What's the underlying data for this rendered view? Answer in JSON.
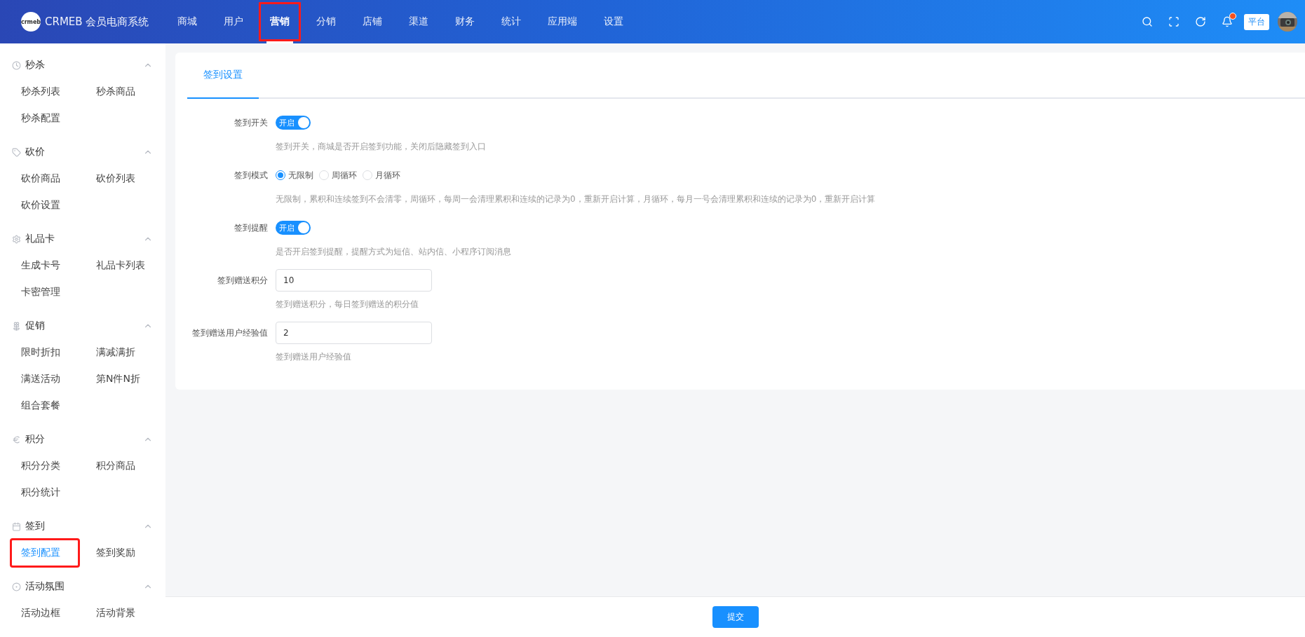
{
  "header": {
    "logo_text": "crmeb",
    "brand": "CRMEB 会员电商系统",
    "nav": [
      {
        "label": "商城",
        "selected": false,
        "highlighted": false
      },
      {
        "label": "用户",
        "selected": false,
        "highlighted": false
      },
      {
        "label": "营销",
        "selected": true,
        "highlighted": true
      },
      {
        "label": "分销",
        "selected": false,
        "highlighted": false
      },
      {
        "label": "店铺",
        "selected": false,
        "highlighted": false
      },
      {
        "label": "渠道",
        "selected": false,
        "highlighted": false
      },
      {
        "label": "财务",
        "selected": false,
        "highlighted": false
      },
      {
        "label": "统计",
        "selected": false,
        "highlighted": false
      },
      {
        "label": "应用端",
        "selected": false,
        "highlighted": false
      },
      {
        "label": "设置",
        "selected": false,
        "highlighted": false
      }
    ],
    "notification_dot": true,
    "platform_badge": "平台"
  },
  "sidebar": {
    "groups": [
      {
        "title": "秒杀",
        "expanded": true,
        "items": [
          {
            "label": "秒杀列表",
            "selected": false,
            "highlighted": false
          },
          {
            "label": "秒杀商品",
            "selected": false,
            "highlighted": false
          },
          {
            "label": "秒杀配置",
            "selected": false,
            "highlighted": false
          }
        ]
      },
      {
        "title": "砍价",
        "expanded": true,
        "items": [
          {
            "label": "砍价商品",
            "selected": false,
            "highlighted": false
          },
          {
            "label": "砍价列表",
            "selected": false,
            "highlighted": false
          },
          {
            "label": "砍价设置",
            "selected": false,
            "highlighted": false
          }
        ]
      },
      {
        "title": "礼品卡",
        "expanded": true,
        "items": [
          {
            "label": "生成卡号",
            "selected": false,
            "highlighted": false
          },
          {
            "label": "礼品卡列表",
            "selected": false,
            "highlighted": false
          },
          {
            "label": "卡密管理",
            "selected": false,
            "highlighted": false
          }
        ]
      },
      {
        "title": "促销",
        "expanded": true,
        "items": [
          {
            "label": "限时折扣",
            "selected": false,
            "highlighted": false
          },
          {
            "label": "满减满折",
            "selected": false,
            "highlighted": false
          },
          {
            "label": "满送活动",
            "selected": false,
            "highlighted": false
          },
          {
            "label": "第N件N折",
            "selected": false,
            "highlighted": false
          },
          {
            "label": "组合套餐",
            "selected": false,
            "highlighted": false
          }
        ]
      },
      {
        "title": "积分",
        "expanded": true,
        "items": [
          {
            "label": "积分分类",
            "selected": false,
            "highlighted": false
          },
          {
            "label": "积分商品",
            "selected": false,
            "highlighted": false
          },
          {
            "label": "积分统计",
            "selected": false,
            "highlighted": false
          }
        ]
      },
      {
        "title": "签到",
        "expanded": true,
        "items": [
          {
            "label": "签到配置",
            "selected": true,
            "highlighted": true
          },
          {
            "label": "签到奖励",
            "selected": false,
            "highlighted": false
          }
        ]
      },
      {
        "title": "活动氛围",
        "expanded": true,
        "items": [
          {
            "label": "活动边框",
            "selected": false,
            "highlighted": false
          },
          {
            "label": "活动背景",
            "selected": false,
            "highlighted": false
          }
        ]
      }
    ]
  },
  "content": {
    "tabs": [
      {
        "label": "签到设置",
        "selected": true
      }
    ],
    "fields": [
      {
        "kind": "switch",
        "label": "签到开关",
        "on": true,
        "switch_text": "开启",
        "hint": "签到开关，商城是否开启签到功能，关闭后隐藏签到入口"
      },
      {
        "kind": "radio",
        "label": "签到模式",
        "options": [
          {
            "label": "无限制",
            "selected": true
          },
          {
            "label": "周循环",
            "selected": false
          },
          {
            "label": "月循环",
            "selected": false
          }
        ],
        "hint": "无限制，累积和连续签到不会清零，周循环，每周一会清理累积和连续的记录为0，重新开启计算，月循环，每月一号会清理累积和连续的记录为0，重新开启计算"
      },
      {
        "kind": "switch",
        "label": "签到提醒",
        "on": true,
        "switch_text": "开启",
        "hint": "是否开启签到提醒，提醒方式为短信、站内信、小程序订阅消息"
      },
      {
        "kind": "input",
        "label": "签到赠送积分",
        "value": "10",
        "hint": "签到赠送积分，每日签到赠送的积分值"
      },
      {
        "kind": "input",
        "label": "签到赠送用户经验值",
        "value": "2",
        "hint": "签到赠送用户经验值"
      }
    ]
  },
  "footer": {
    "submit": "提交"
  }
}
